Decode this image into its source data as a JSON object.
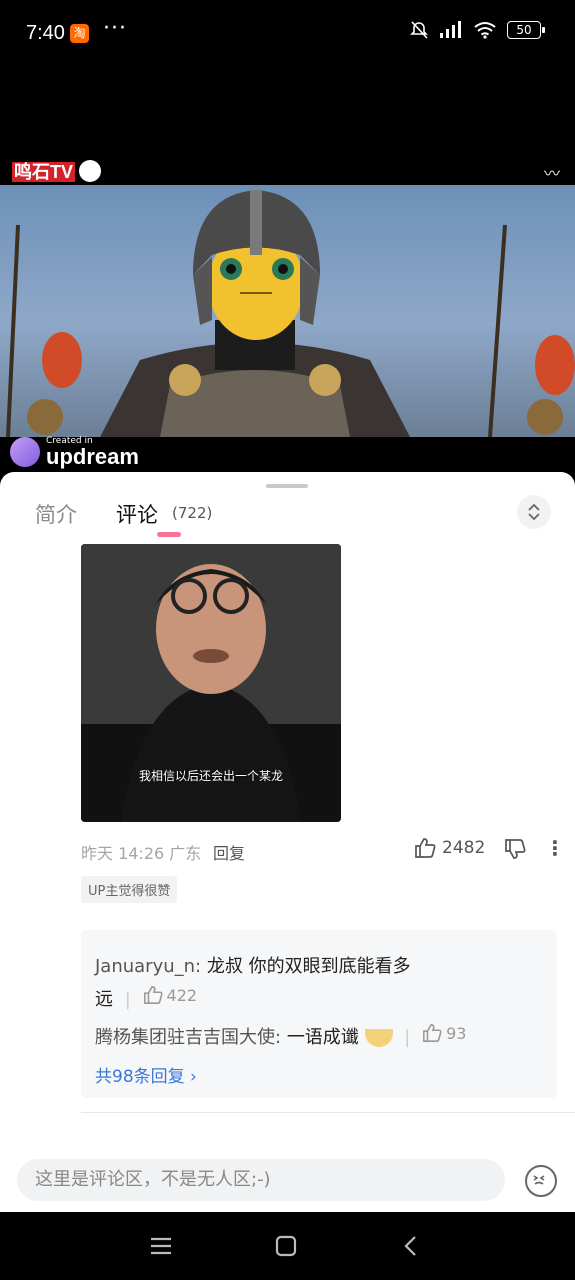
{
  "status_bar": {
    "time": "7:40",
    "app_badge": "淘",
    "more_dots": "···",
    "battery": "50"
  },
  "video": {
    "channel_logo": "鸣石TV",
    "watermark": "Created in",
    "watermark_brand": "updream"
  },
  "tabs": {
    "intro": "简介",
    "comments": "评论",
    "comment_count": "(722)"
  },
  "comment": {
    "image_caption": "我相信以后还会出一个某龙",
    "meta": "昨天 14:26 广东",
    "reply_label": "回复",
    "likes": "2482",
    "up_badge": "UP主觉得很赞"
  },
  "replies": [
    {
      "name": "Januaryu_n:",
      "text": "龙叔 你的双眼到底能看多",
      "text2": "远",
      "likes": "422"
    },
    {
      "name": "腾杨集团驻吉吉国大使:",
      "text": "一语成谶",
      "likes": "93"
    }
  ],
  "more_replies": "共98条回复",
  "input": {
    "placeholder": "这里是评论区，不是无人区;-)"
  }
}
